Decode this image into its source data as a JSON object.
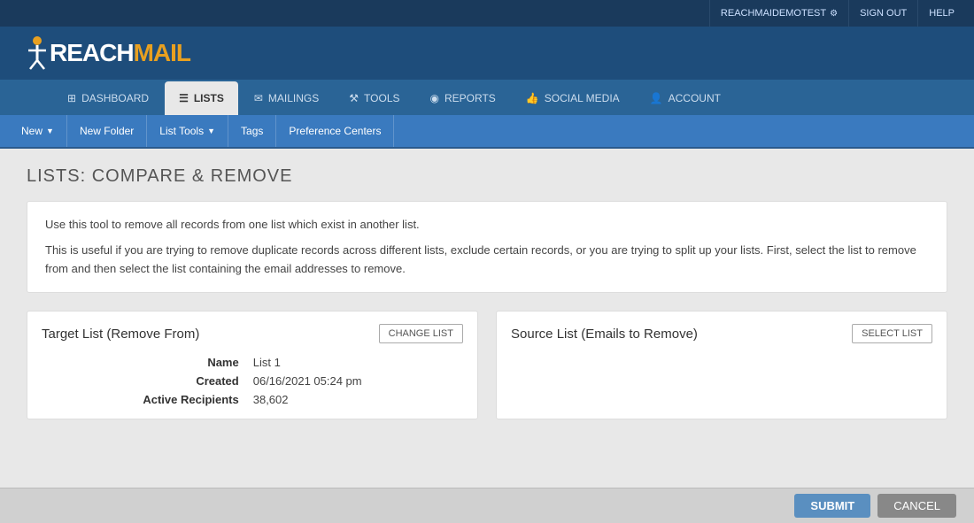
{
  "topbar": {
    "username": "REACHMAIDEMOTEST",
    "gear_symbol": "⚙",
    "signout": "SIGN OUT",
    "help": "HELP"
  },
  "logo": {
    "reach": "RE",
    "ach": "ACH",
    "mail": "MAIL"
  },
  "mainnav": {
    "items": [
      {
        "id": "dashboard",
        "icon": "⊞",
        "label": "DASHBOARD",
        "active": false
      },
      {
        "id": "lists",
        "icon": "≡",
        "label": "LISTS",
        "active": true
      },
      {
        "id": "mailings",
        "icon": "✉",
        "label": "MAILINGS",
        "active": false
      },
      {
        "id": "tools",
        "icon": "⚒",
        "label": "TOOLS",
        "active": false
      },
      {
        "id": "reports",
        "icon": "📊",
        "label": "REPORTS",
        "active": false
      },
      {
        "id": "social-media",
        "icon": "👍",
        "label": "SOCIAL MEDIA",
        "active": false
      },
      {
        "id": "account",
        "icon": "👤",
        "label": "ACCOUNT",
        "active": false
      }
    ]
  },
  "subnav": {
    "items": [
      {
        "id": "new",
        "label": "New",
        "has_arrow": true
      },
      {
        "id": "new-folder",
        "label": "New Folder",
        "has_arrow": false
      },
      {
        "id": "list-tools",
        "label": "List Tools",
        "has_arrow": true
      },
      {
        "id": "tags",
        "label": "Tags",
        "has_arrow": false
      },
      {
        "id": "preference-centers",
        "label": "Preference Centers",
        "has_arrow": false
      }
    ]
  },
  "page": {
    "title": "LISTS: COMPARE & REMOVE",
    "info_line1": "Use this tool to remove all records from one list which exist in another list.",
    "info_line2": "This is useful if you are trying to remove duplicate records across different lists, exclude certain records, or you are trying to split up your lists. First, select the list to remove from and then select the list containing the email addresses to remove."
  },
  "target_panel": {
    "title": "Target List (Remove From)",
    "button": "CHANGE LIST",
    "name_label": "Name",
    "name_value": "List 1",
    "created_label": "Created",
    "created_value": "06/16/2021 05:24 pm",
    "recipients_label": "Active Recipients",
    "recipients_value": "38,602"
  },
  "source_panel": {
    "title": "Source List (Emails to Remove)",
    "button": "SELECT LIST"
  },
  "actions": {
    "submit": "SUBMIT",
    "cancel": "CANCEL"
  }
}
